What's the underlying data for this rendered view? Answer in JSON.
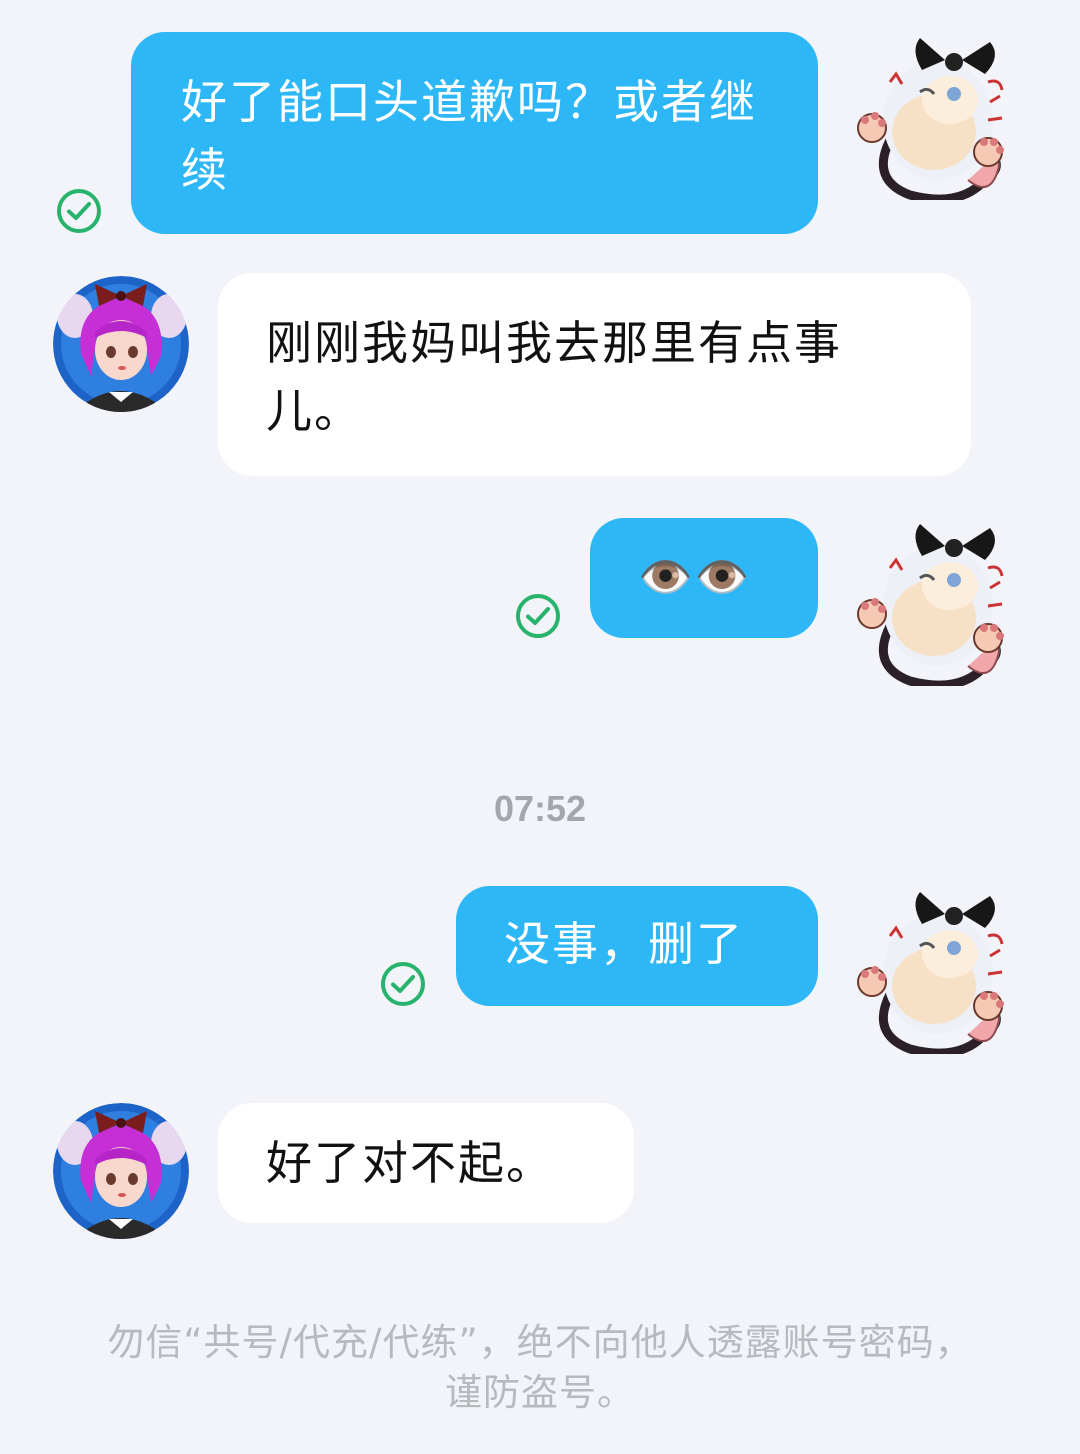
{
  "messages": [
    {
      "sender": "self",
      "text": "好了能口头道歉吗？或者继续",
      "status": "read"
    },
    {
      "sender": "other",
      "text": " 刚刚我妈叫我去那里有点事儿。"
    },
    {
      "sender": "self",
      "text": "👁️👁️",
      "status": "read"
    },
    {
      "sender": "self",
      "text": "没事，删了",
      "status": "read"
    },
    {
      "sender": "other",
      "text": "好了对不起。"
    }
  ],
  "timestamp": "07:52",
  "notice": "勿信“共号/代充/代练”，绝不向他人透露账号密码，谨防盗号。",
  "colors": {
    "background": "#f3f4f9",
    "self_bubble": "#2db7f7",
    "other_bubble": "#ffffff",
    "read_check": "#27b36b",
    "timestamp": "#a3a7ad",
    "notice": "#b6b9be"
  },
  "icons": {
    "read_indicator": "check-circle-icon",
    "self_avatar": "cat-girl-avatar",
    "other_avatar": "purple-hair-girl-avatar"
  }
}
